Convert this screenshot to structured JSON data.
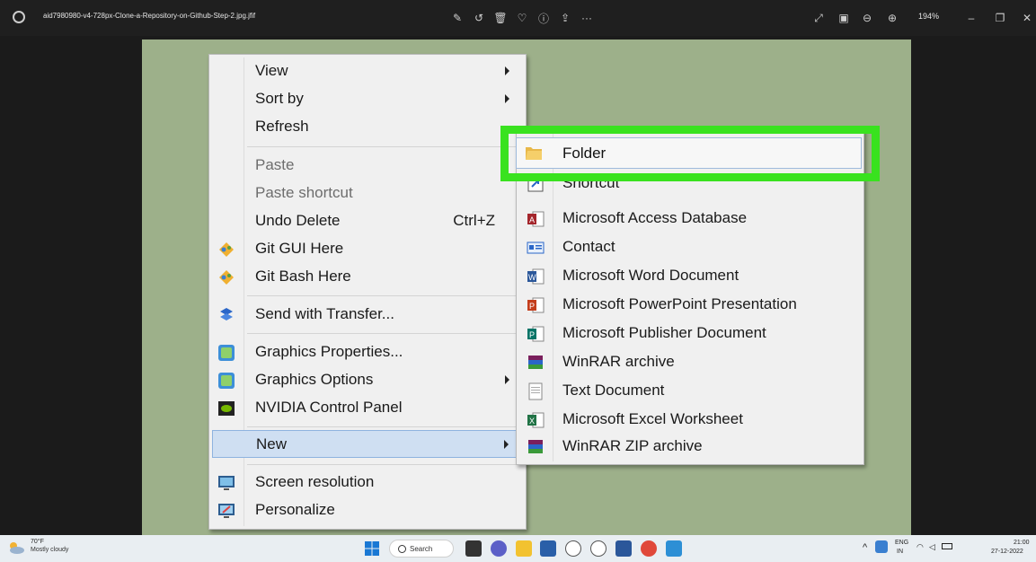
{
  "titlebar": {
    "filename": "aid7980980-v4-728px-Clone-a-Repository-on-Github-Step-2.jpg.jfif",
    "zoom": "194%",
    "more": "···"
  },
  "context_menu": {
    "items": [
      {
        "label": "View",
        "submenu": true
      },
      {
        "label": "Sort by",
        "submenu": true
      },
      {
        "label": "Refresh"
      },
      {
        "label": "Paste",
        "disabled": true
      },
      {
        "label": "Paste shortcut",
        "disabled": true
      },
      {
        "label": "Undo Delete",
        "shortcut": "Ctrl+Z"
      },
      {
        "label": "Git GUI Here",
        "icon": "git-icon"
      },
      {
        "label": "Git Bash Here",
        "icon": "git-icon"
      },
      {
        "label": "Send with Transfer...",
        "icon": "transfer-icon"
      },
      {
        "label": "Graphics Properties...",
        "icon": "graphics-icon"
      },
      {
        "label": "Graphics Options",
        "icon": "graphics-icon",
        "submenu": true
      },
      {
        "label": "NVIDIA Control Panel",
        "icon": "nvidia-icon"
      },
      {
        "label": "New",
        "submenu": true,
        "selected": true
      },
      {
        "label": "Screen resolution",
        "icon": "monitor-icon"
      },
      {
        "label": "Personalize",
        "icon": "personalize-icon"
      }
    ]
  },
  "new_submenu": {
    "items": [
      {
        "label": "Folder",
        "icon": "folder-icon",
        "highlighted": true
      },
      {
        "label": "Shortcut",
        "icon": "shortcut-icon"
      },
      {
        "label": "Microsoft Access Database",
        "icon": "access-icon"
      },
      {
        "label": "Contact",
        "icon": "contact-icon"
      },
      {
        "label": "Microsoft Word Document",
        "icon": "word-icon"
      },
      {
        "label": "Microsoft PowerPoint Presentation",
        "icon": "powerpoint-icon"
      },
      {
        "label": "Microsoft Publisher Document",
        "icon": "publisher-icon"
      },
      {
        "label": "WinRAR archive",
        "icon": "winrar-icon"
      },
      {
        "label": "Text Document",
        "icon": "text-document-icon"
      },
      {
        "label": "Microsoft Excel Worksheet",
        "icon": "excel-icon"
      },
      {
        "label": "WinRAR ZIP archive",
        "icon": "winrar-zip-icon"
      }
    ]
  },
  "taskbar": {
    "weather_temp": "70°F",
    "weather_condition": "Mostly cloudy",
    "search_label": "Search",
    "lang_line1": "ENG",
    "lang_line2": "IN",
    "time": "21:00",
    "date": "27-12-2022"
  },
  "colors": {
    "highlight_box": "#39e21f",
    "photo_background": "#9db08a",
    "menu_background": "#f0f0f0"
  }
}
